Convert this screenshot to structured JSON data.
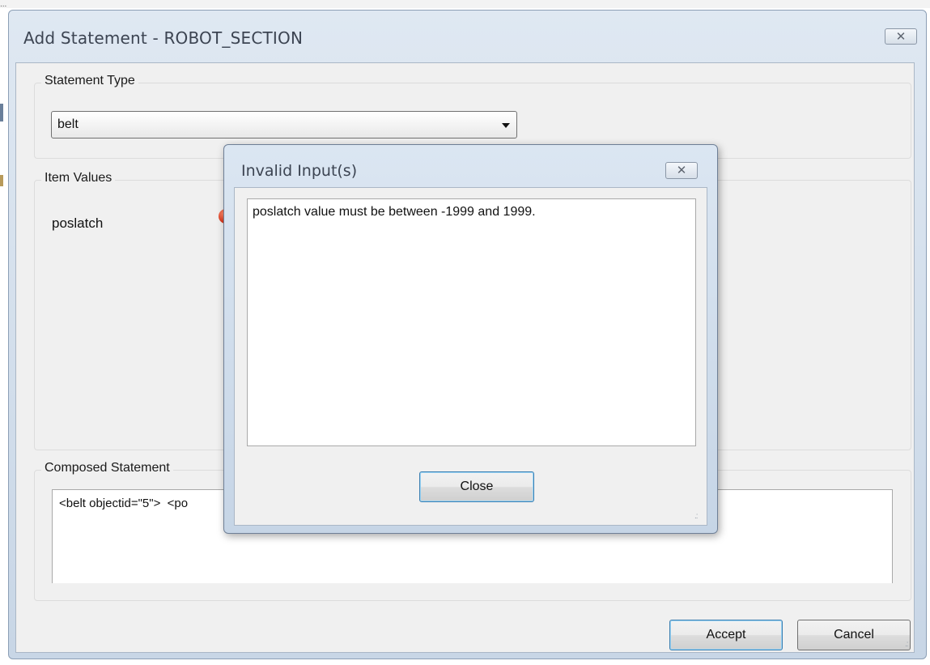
{
  "background": {
    "title_fragment": "..."
  },
  "main_dialog": {
    "title": "Add Statement - ROBOT_SECTION",
    "close_glyph": "✕",
    "statement_type": {
      "group_label": "Statement Type",
      "selected_value": "belt"
    },
    "item_values": {
      "group_label": "Item Values",
      "fields": [
        {
          "label": "poslatch",
          "has_error": true
        }
      ]
    },
    "composed_statement": {
      "group_label": "Composed Statement",
      "text": "<belt objectid=\"5\">  <po"
    },
    "buttons": {
      "accept_label": "Accept",
      "cancel_label": "Cancel"
    }
  },
  "error_popup": {
    "title": "Invalid Input(s)",
    "close_glyph": "✕",
    "message": "poslatch value must be between -1999 and 1999.",
    "close_button_label": "Close"
  },
  "icons": {
    "error_icon": "error-icon",
    "dropdown": "chevron-down-icon",
    "resize_grip": "resize-grip-icon"
  },
  "colors": {
    "frame": "#c8d6e6",
    "client": "#f0f0f0",
    "focus_border": "#3c7fb1",
    "error_red": "#d9381e"
  }
}
